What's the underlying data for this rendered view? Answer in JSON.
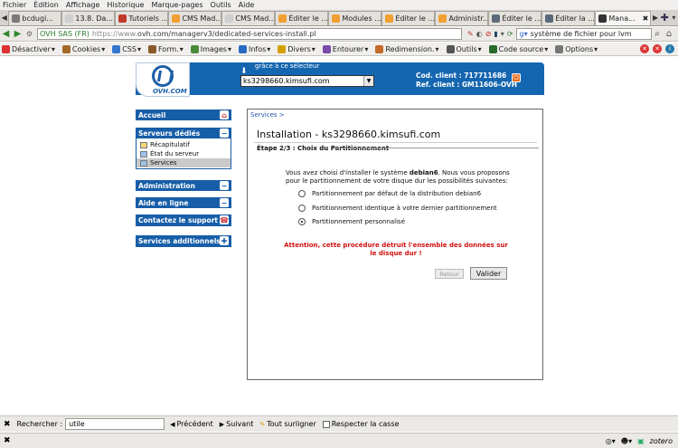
{
  "menu": [
    "Fichier",
    "Édition",
    "Affichage",
    "Historique",
    "Marque-pages",
    "Outils",
    "Aide"
  ],
  "tabs": [
    {
      "label": "bcdugi...",
      "color": "#7a7a7a"
    },
    {
      "label": "13.8. Da...",
      "color": "#cfcfcf"
    },
    {
      "label": "Tutoriels ...",
      "color": "#c0392b"
    },
    {
      "label": "CMS Mad...",
      "color": "#f0a030"
    },
    {
      "label": "CMS Mad...",
      "color": "#cfcfcf"
    },
    {
      "label": "Éditer le ...",
      "color": "#f0a030"
    },
    {
      "label": "Modules ...",
      "color": "#f0a030"
    },
    {
      "label": "Éditer le ...",
      "color": "#f0a030"
    },
    {
      "label": "Administr...",
      "color": "#f0a030"
    },
    {
      "label": "Éditer le ...",
      "color": "#5a6a7a"
    },
    {
      "label": "Éditer la ...",
      "color": "#5a6a7a"
    },
    {
      "label": "Mana...",
      "color": "#333333",
      "active": true
    }
  ],
  "nav": {
    "site_identity": "OVH SAS (FR)",
    "url_scheme": "https://www.",
    "url_rest": "ovh.com/managerv3/dedicated-services-install.pl",
    "search_value": "système de fichier pour lvm"
  },
  "toolbar": [
    "Désactiver",
    "Cookies",
    "CSS",
    "Form.",
    "Images",
    "Infos",
    "Divers",
    "Entourer",
    "Redimension.",
    "Outils",
    "Code source",
    "Options"
  ],
  "header": {
    "logo_text": "OVH.COM",
    "hint": "grâce à ce sélecteur",
    "server": "ks3298660.kimsufi.com",
    "client_code": "Cod. client : 717711686",
    "client_ref": "Ref. client : GM11606-OVH"
  },
  "sidebar": {
    "accueil": "Accueil",
    "serveurs": "Serveurs dédiés",
    "sub_items": [
      "Récapitulatif",
      "État du serveur",
      "Services"
    ],
    "administration": "Administration",
    "aide": "Aide en ligne",
    "support": "Contactez le support",
    "additionnels": "Services additionnels"
  },
  "content": {
    "breadcrumb": "Services >",
    "title": "Installation - ks3298660.kimsufi.com",
    "step": "Étape 2/3 : Choix du Partitionnement",
    "intro_pre": "Vous avez choisi d'installer le système ",
    "intro_os": "debian6",
    "intro_post": ". Nous vous proposons pour le partitionnement de votre disque dur les possibilités suivantes:",
    "options": [
      {
        "label": "Partitionnement par défaut de la distribution debian6",
        "checked": false
      },
      {
        "label": "Partitionnement identique à votre dernier partitionnement",
        "checked": false
      },
      {
        "label": "Partitionnement personnalisé",
        "checked": true
      }
    ],
    "warning": "Attention, cette procédure détruit l'ensemble des données sur le disque dur !",
    "retour": "Retour",
    "valider": "Valider"
  },
  "findbar": {
    "label": "Rechercher :",
    "value": "utile",
    "previous": "Précédent",
    "next": "Suivant",
    "highlight": "Tout surligner",
    "match_case": "Respecter la casse"
  },
  "status": {
    "zotero": "zotero"
  }
}
